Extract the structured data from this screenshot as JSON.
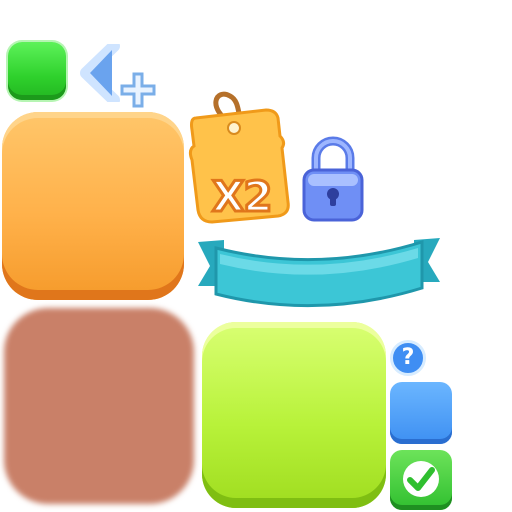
{
  "badges": {
    "multiplier_label": "X2",
    "help_glyph": "?"
  },
  "icons": [
    "green-square-button",
    "back-arrow-icon",
    "plus-icon",
    "multiplier-tag-icon",
    "lock-icon",
    "ribbon-banner",
    "help-icon",
    "blue-square-button",
    "checkmark-icon"
  ],
  "colors": {
    "orange_tile": "#ffb14a",
    "lime_tile": "#b8f23a",
    "green_button": "#2fd12c",
    "blue_button": "#3d8ff2",
    "ribbon": "#3cc6d6",
    "lock": "#6f8ff5",
    "brown_tile": "#c98068"
  }
}
